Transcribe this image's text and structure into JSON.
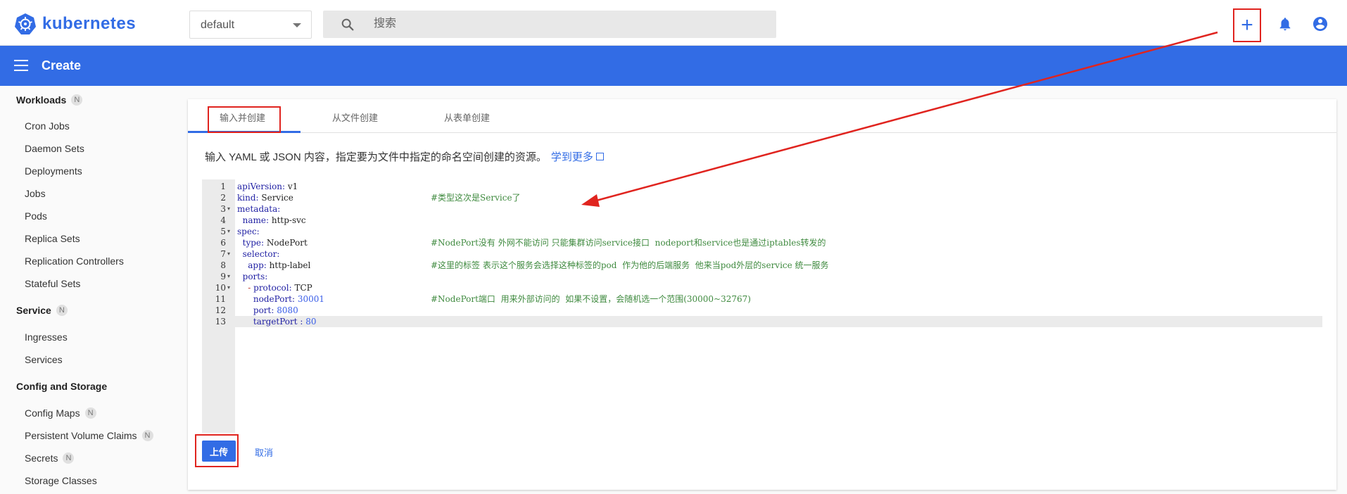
{
  "app": {
    "name": "kubernetes"
  },
  "namespace": {
    "selected": "default"
  },
  "search": {
    "placeholder": "搜索"
  },
  "toolbar": {
    "create_icon": "plus-icon",
    "notifications_icon": "bell-icon",
    "account_icon": "account-circle-icon"
  },
  "header": {
    "title": "Create"
  },
  "sidebar": {
    "workloads": {
      "label": "Workloads",
      "badge": "N",
      "items": [
        "Cron Jobs",
        "Daemon Sets",
        "Deployments",
        "Jobs",
        "Pods",
        "Replica Sets",
        "Replication Controllers",
        "Stateful Sets"
      ]
    },
    "service": {
      "label": "Service",
      "badge": "N",
      "items": [
        "Ingresses",
        "Services"
      ]
    },
    "config": {
      "label": "Config and Storage",
      "items": [
        "Config Maps",
        "Persistent Volume Claims",
        "Secrets",
        "Storage Classes"
      ],
      "item_badges": [
        "N",
        "N",
        "N",
        ""
      ]
    }
  },
  "tabs": [
    {
      "label": "输入并创建",
      "active": true
    },
    {
      "label": "从文件创建",
      "active": false
    },
    {
      "label": "从表单创建",
      "active": false
    }
  ],
  "description": {
    "text": "输入 YAML 或 JSON 内容，指定要为文件中指定的命名空间创建的资源。",
    "learn_more": "学到更多"
  },
  "editor": {
    "lines": [
      {
        "num": "1",
        "fold": false,
        "code": "apiVersion: v1",
        "comment": ""
      },
      {
        "num": "2",
        "fold": false,
        "code": "kind: Service",
        "comment": "#类型这次是Service了"
      },
      {
        "num": "3",
        "fold": true,
        "code": "metadata:",
        "comment": ""
      },
      {
        "num": "4",
        "fold": false,
        "code": "  name: http-svc",
        "comment": ""
      },
      {
        "num": "5",
        "fold": true,
        "code": "spec:",
        "comment": ""
      },
      {
        "num": "6",
        "fold": false,
        "code": "  type: NodePort",
        "comment": "#NodePort没有 外网不能访问 只能集群访问service接口  nodeport和service也是通过iptables转发的"
      },
      {
        "num": "7",
        "fold": true,
        "code": "  selector:",
        "comment": ""
      },
      {
        "num": "8",
        "fold": false,
        "code": "    app: http-label",
        "comment": "#这里的标签 表示这个服务会选择这种标签的pod  作为他的后端服务  他来当pod外层的service 统一服务"
      },
      {
        "num": "9",
        "fold": true,
        "code": "  ports:",
        "comment": ""
      },
      {
        "num": "10",
        "fold": true,
        "code": "    - protocol: TCP",
        "comment": ""
      },
      {
        "num": "11",
        "fold": false,
        "code": "      nodePort: 30001",
        "comment": "#NodePort端口  用来外部访问的  如果不设置，会随机选一个范围(30000~32767)"
      },
      {
        "num": "12",
        "fold": false,
        "code": "      port: 8080",
        "comment": ""
      },
      {
        "num": "13",
        "fold": false,
        "code": "      targetPort : 80",
        "comment": ""
      }
    ],
    "active_line": "13"
  },
  "actions": {
    "upload": "上传",
    "cancel": "取消"
  },
  "colors": {
    "brand": "#326ce5",
    "annotation": "#e0241f"
  }
}
